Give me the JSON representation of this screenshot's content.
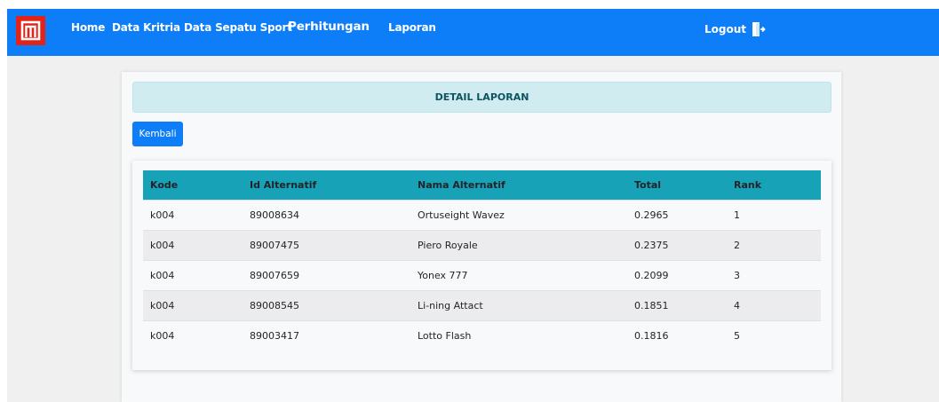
{
  "nav": {
    "home": "Home",
    "kriteria": "Data Kritria",
    "sepatu": "Data Sepatu Sport",
    "perhitungan": "Perhitungan",
    "laporan": "Laporan",
    "logout": "Logout"
  },
  "logo_icon": "brand-logo-icon",
  "logout_icon": "sign-out-icon",
  "colors": {
    "navbar": "#0d7ef7",
    "logo": "#e2231a",
    "table_header": "#17a2b8",
    "alert_bg": "#d1ecf1",
    "alert_text": "#0c5460"
  },
  "panel": {
    "title": "DETAIL LAPORAN",
    "back_button": "Kembali"
  },
  "table": {
    "headers": [
      "Kode",
      "Id Alternatif",
      "Nama Alternatif",
      "Total",
      "Rank"
    ],
    "rows": [
      [
        "k004",
        "89008634",
        "Ortuseight Wavez",
        "0.2965",
        "1"
      ],
      [
        "k004",
        "89007475",
        "Piero Royale",
        "0.2375",
        "2"
      ],
      [
        "k004",
        "89007659",
        "Yonex 777",
        "0.2099",
        "3"
      ],
      [
        "k004",
        "89008545",
        "Li-ning Attact",
        "0.1851",
        "4"
      ],
      [
        "k004",
        "89003417",
        "Lotto Flash",
        "0.1816",
        "5"
      ]
    ]
  }
}
